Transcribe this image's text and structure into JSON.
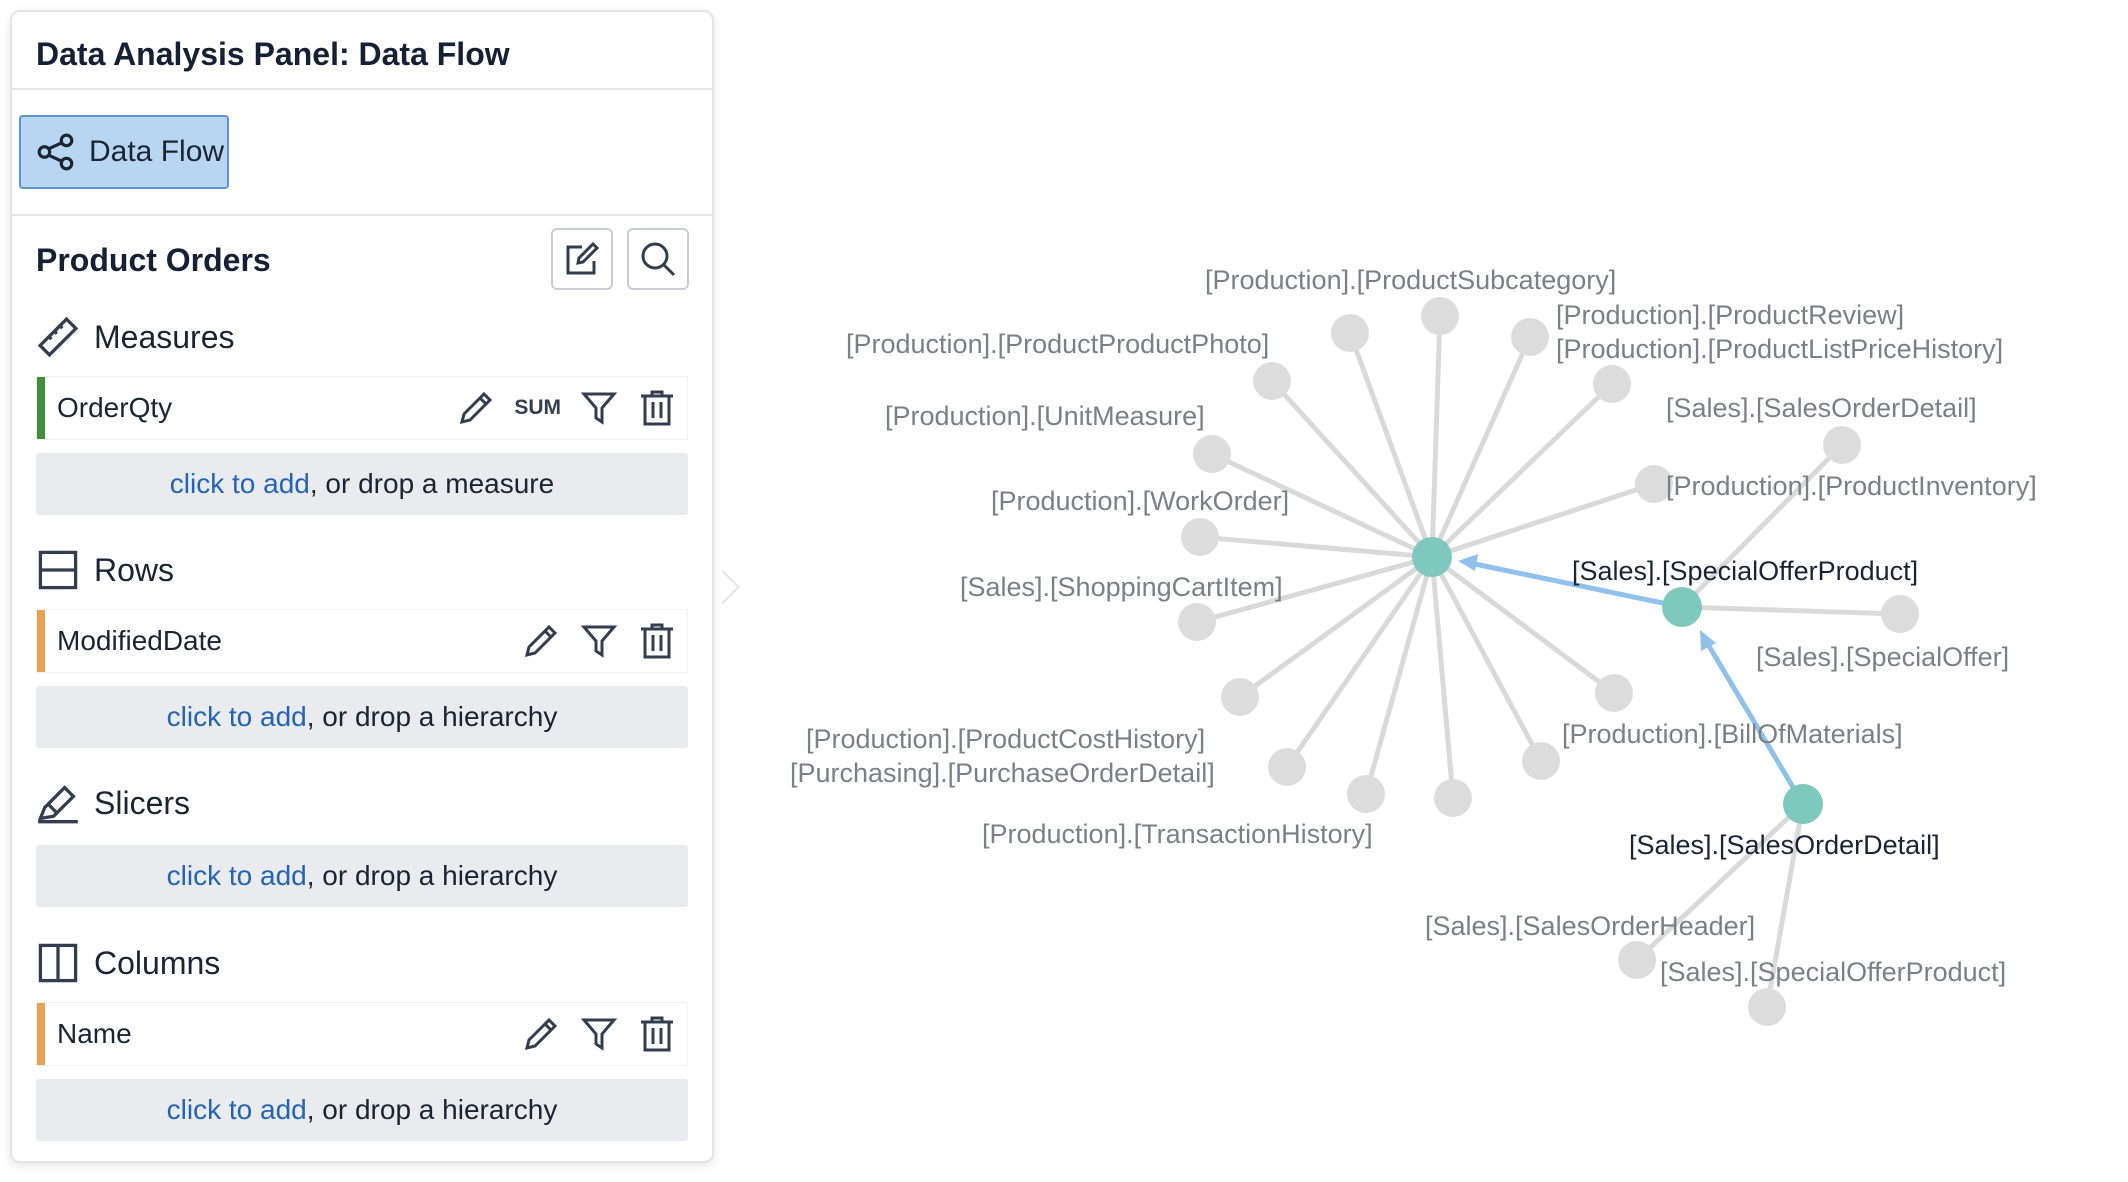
{
  "panel": {
    "title": "Data Analysis Panel: Data Flow",
    "toolbar": {
      "data_flow_label": "Data Flow",
      "data_flow_icon": "share-nodes-icon"
    },
    "report_title": "Product Orders",
    "groups": {
      "measures": {
        "label": "Measures",
        "field": {
          "name": "OrderQty",
          "aggregate": "SUM",
          "color": "#3e8e3e"
        },
        "drop_link": "click to add",
        "drop_rest": ", or drop a measure"
      },
      "rows": {
        "label": "Rows",
        "field": {
          "name": "ModifiedDate",
          "color": "#e8a055"
        },
        "drop_link": "click to add",
        "drop_rest": ", or drop a hierarchy"
      },
      "slicers": {
        "label": "Slicers",
        "drop_link": "click to add",
        "drop_rest": ", or drop a hierarchy"
      },
      "columns": {
        "label": "Columns",
        "field": {
          "name": "Name",
          "color": "#e8a055"
        },
        "drop_link": "click to add",
        "drop_rest": ", or drop a hierarchy"
      }
    }
  },
  "graph": {
    "colors": {
      "active_node": "#7ec8be",
      "inactive_node": "#dcdcdc",
      "edge": "#d9d9d9",
      "active_edge": "#8fc1ea"
    },
    "labels": {
      "center_children": [
        "[Production].[ProductSubcategory]",
        "[Production].[ProductReview]",
        "[Production].[ProductListPriceHistory]",
        "[Production].[ProductProductPhoto]",
        "[Production].[UnitMeasure]",
        "[Production].[ProductInventory]",
        "[Production].[WorkOrder]",
        "[Sales].[ShoppingCartItem]",
        "[Production].[ProductCostHistory]",
        "[Purchasing].[PurchaseOrderDetail]",
        "[Production].[TransactionHistory]",
        "[Production].[BillOfMaterials]"
      ],
      "special_offer_product": "[Sales].[SpecialOfferProduct]",
      "sales_order_detail_upper": "[Sales].[SalesOrderDetail]",
      "special_offer": "[Sales].[SpecialOffer]",
      "sales_order_detail": "[Sales].[SalesOrderDetail]",
      "sales_order_header": "[Sales].[SalesOrderHeader]",
      "special_offer_product_lower": "[Sales].[SpecialOfferProduct]"
    }
  }
}
